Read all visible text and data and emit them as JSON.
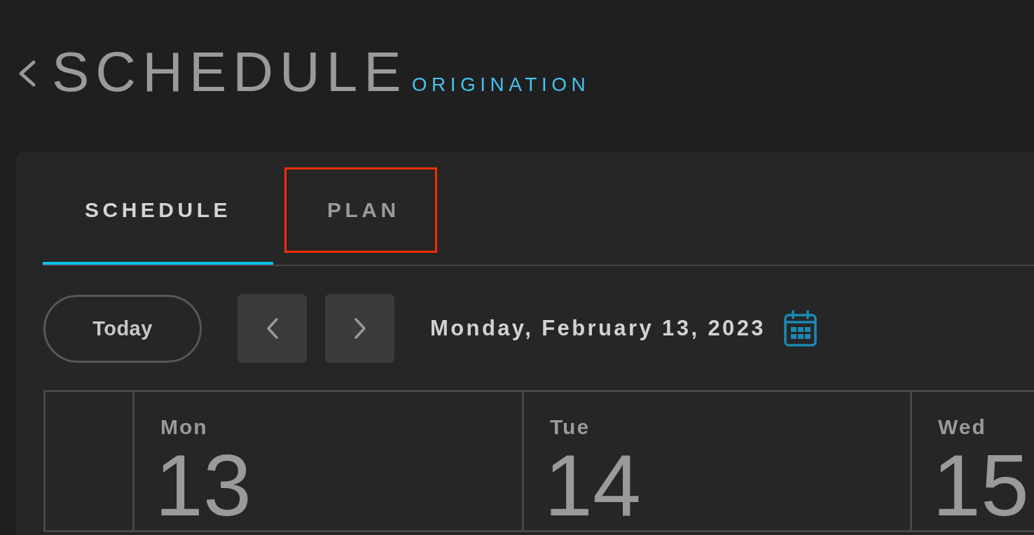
{
  "header": {
    "title": "SCHEDULE",
    "subtitle": "ORIGINATION"
  },
  "tabs": [
    {
      "label": "SCHEDULE",
      "selected": true,
      "highlighted": false
    },
    {
      "label": "PLAN",
      "selected": false,
      "highlighted": true
    }
  ],
  "toolbar": {
    "today_button": "Today",
    "date": "Monday, February 13, 2023"
  },
  "week": {
    "days": [
      {
        "weekday": "Mon",
        "date": "13"
      },
      {
        "weekday": "Tue",
        "date": "14"
      },
      {
        "weekday": "Wed",
        "date": "15"
      }
    ]
  }
}
